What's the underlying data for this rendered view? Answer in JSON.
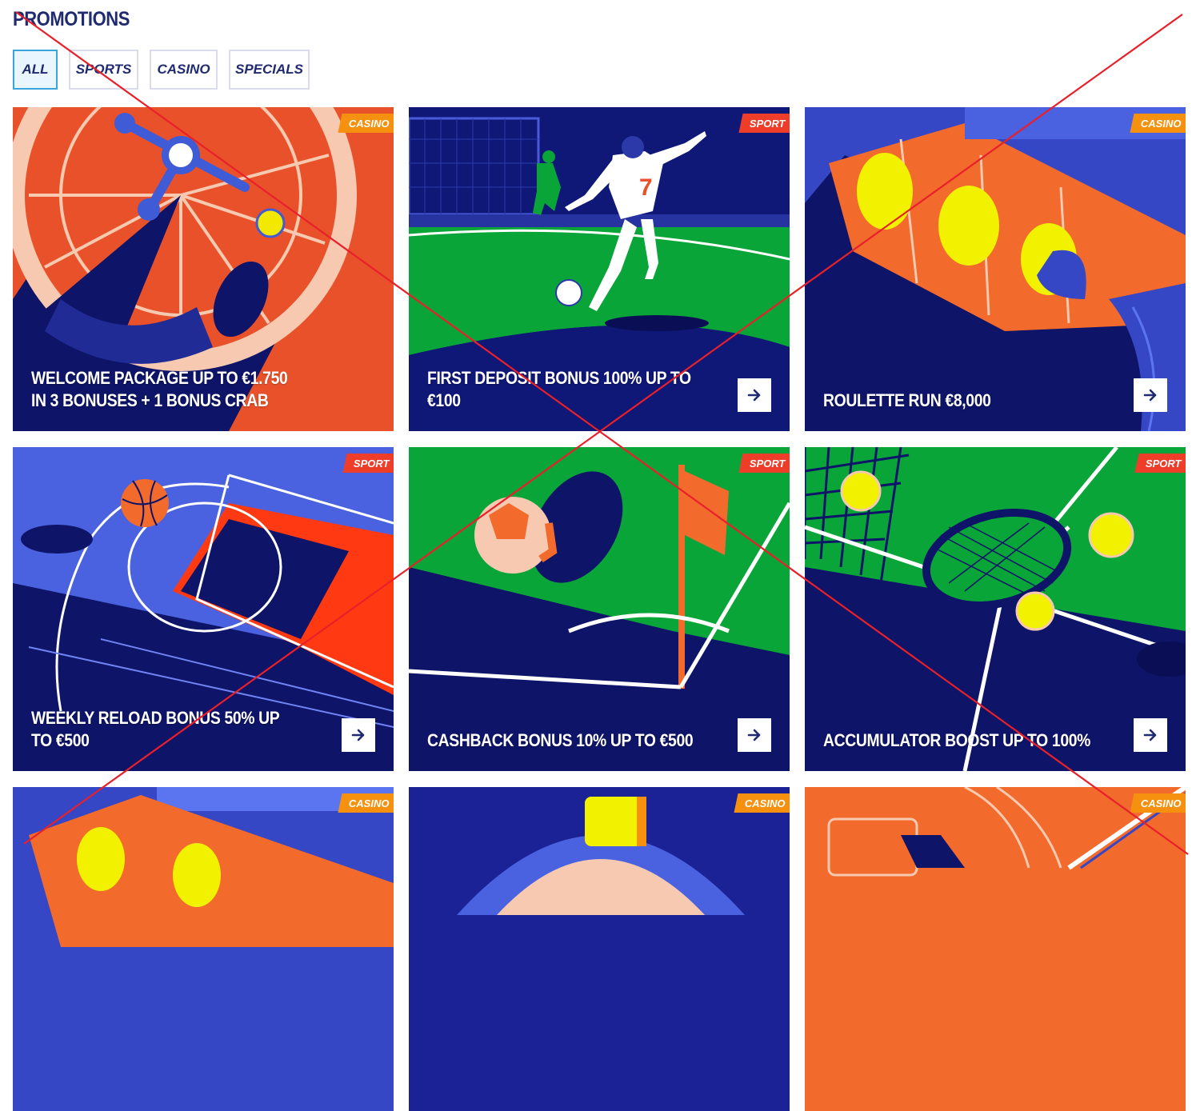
{
  "page": {
    "title": "PROMOTIONS"
  },
  "filters": [
    {
      "label": "ALL",
      "active": true
    },
    {
      "label": "SPORTS",
      "active": false
    },
    {
      "label": "CASINO",
      "active": false
    },
    {
      "label": "SPECIALS",
      "active": false
    }
  ],
  "cards": [
    {
      "tag": "CASINO",
      "title": "WELCOME PACKAGE UP TO €1.750 IN 3 BONUSES + 1 BONUS CRAB",
      "has_arrow": false,
      "art": "roulette-wheel"
    },
    {
      "tag": "SPORT",
      "title": "FIRST DEPOSIT BONUS 100% UP TO €100",
      "has_arrow": true,
      "art": "football-player"
    },
    {
      "tag": "CASINO",
      "title": "ROULETTE RUN €8,000",
      "has_arrow": true,
      "art": "slot-reels"
    },
    {
      "tag": "SPORT",
      "title": "WEEKLY RELOAD BONUS 50% UP TO €500",
      "has_arrow": true,
      "art": "basketball-court"
    },
    {
      "tag": "SPORT",
      "title": "CASHBACK BONUS 10% UP TO €500",
      "has_arrow": true,
      "art": "football-corner"
    },
    {
      "tag": "SPORT",
      "title": "ACCUMULATOR BOOST UP TO 100%",
      "has_arrow": true,
      "art": "tennis"
    },
    {
      "tag": "CASINO",
      "title": "",
      "has_arrow": false,
      "art": "slot-reels"
    },
    {
      "tag": "CASINO",
      "title": "",
      "has_arrow": false,
      "art": "casino-button"
    },
    {
      "tag": "CASINO",
      "title": "",
      "has_arrow": false,
      "art": "roulette-table"
    }
  ],
  "colors": {
    "navy": "#0e1467",
    "title_navy": "#1f2a70",
    "casino_tag": "#f6910f",
    "sport_tag": "#ee3e2a",
    "active_filter_border": "#3aa4dc",
    "cross_red": "#e8202a"
  },
  "icons": {
    "arrow": "arrow-right-icon"
  }
}
